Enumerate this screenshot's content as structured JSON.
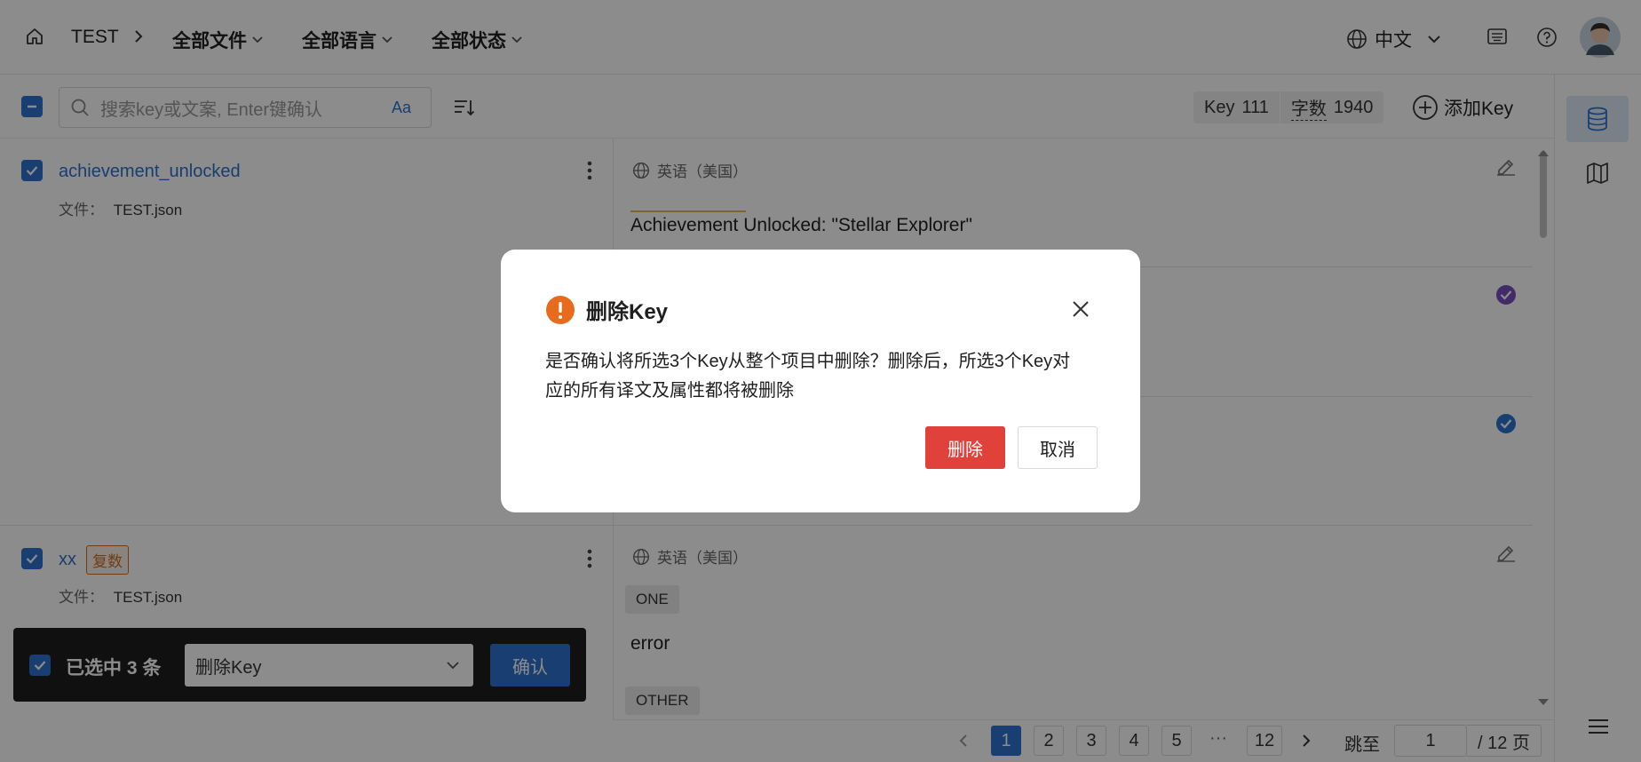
{
  "header": {
    "project": "TEST",
    "filters": [
      "全部文件",
      "全部语言",
      "全部状态"
    ],
    "ui_language": "中文",
    "icons": [
      "home-icon",
      "chevron-right-icon",
      "globe-icon",
      "keyboard-icon",
      "help-icon",
      "user-avatar"
    ]
  },
  "toolbar": {
    "search_placeholder": "搜索key或文案, Enter键确认",
    "case_toggle": "Aa",
    "stats_key_label": "Key",
    "stats_key_count": "111",
    "stats_chars_label": "字数",
    "stats_chars_count": "1940",
    "add_key_label": "添加Key"
  },
  "keys": [
    {
      "name": "achievement_unlocked",
      "file_label": "文件：",
      "file": "TEST.json",
      "lang": "英语（美国）",
      "translation": "Achievement Unlocked: \"Stellar Explorer\""
    },
    {
      "name": "xx",
      "tag": "复数",
      "file_label": "文件：",
      "file": "TEST.json",
      "lang": "英语（美国）",
      "plural_forms": [
        {
          "label": "ONE",
          "text": "error"
        },
        {
          "label": "OTHER",
          "text": ""
        }
      ]
    }
  ],
  "bulk_bar": {
    "selected_text": "已选中 3 条",
    "action": "删除Key",
    "confirm_label": "确认"
  },
  "pagination": {
    "pages": [
      "1",
      "2",
      "3",
      "4",
      "5"
    ],
    "ellipsis": "···",
    "last_page": "12",
    "current_page": "1",
    "jump_label": "跳至",
    "jump_value": "1",
    "total_label": "/ 12 页"
  },
  "modal": {
    "title": "删除Key",
    "body_line1": "是否确认将所选3个Key从整个项目中删除？删除后，所选3个Key对",
    "body_line2": "应的所有译文及属性都将被删除",
    "delete_label": "删除",
    "cancel_label": "取消"
  },
  "colors": {
    "primary": "#2f74d0",
    "danger": "#e0413a",
    "warning": "#e86a1c",
    "tag_orange": "#c8702d",
    "status_purple": "#7b4fc2"
  }
}
